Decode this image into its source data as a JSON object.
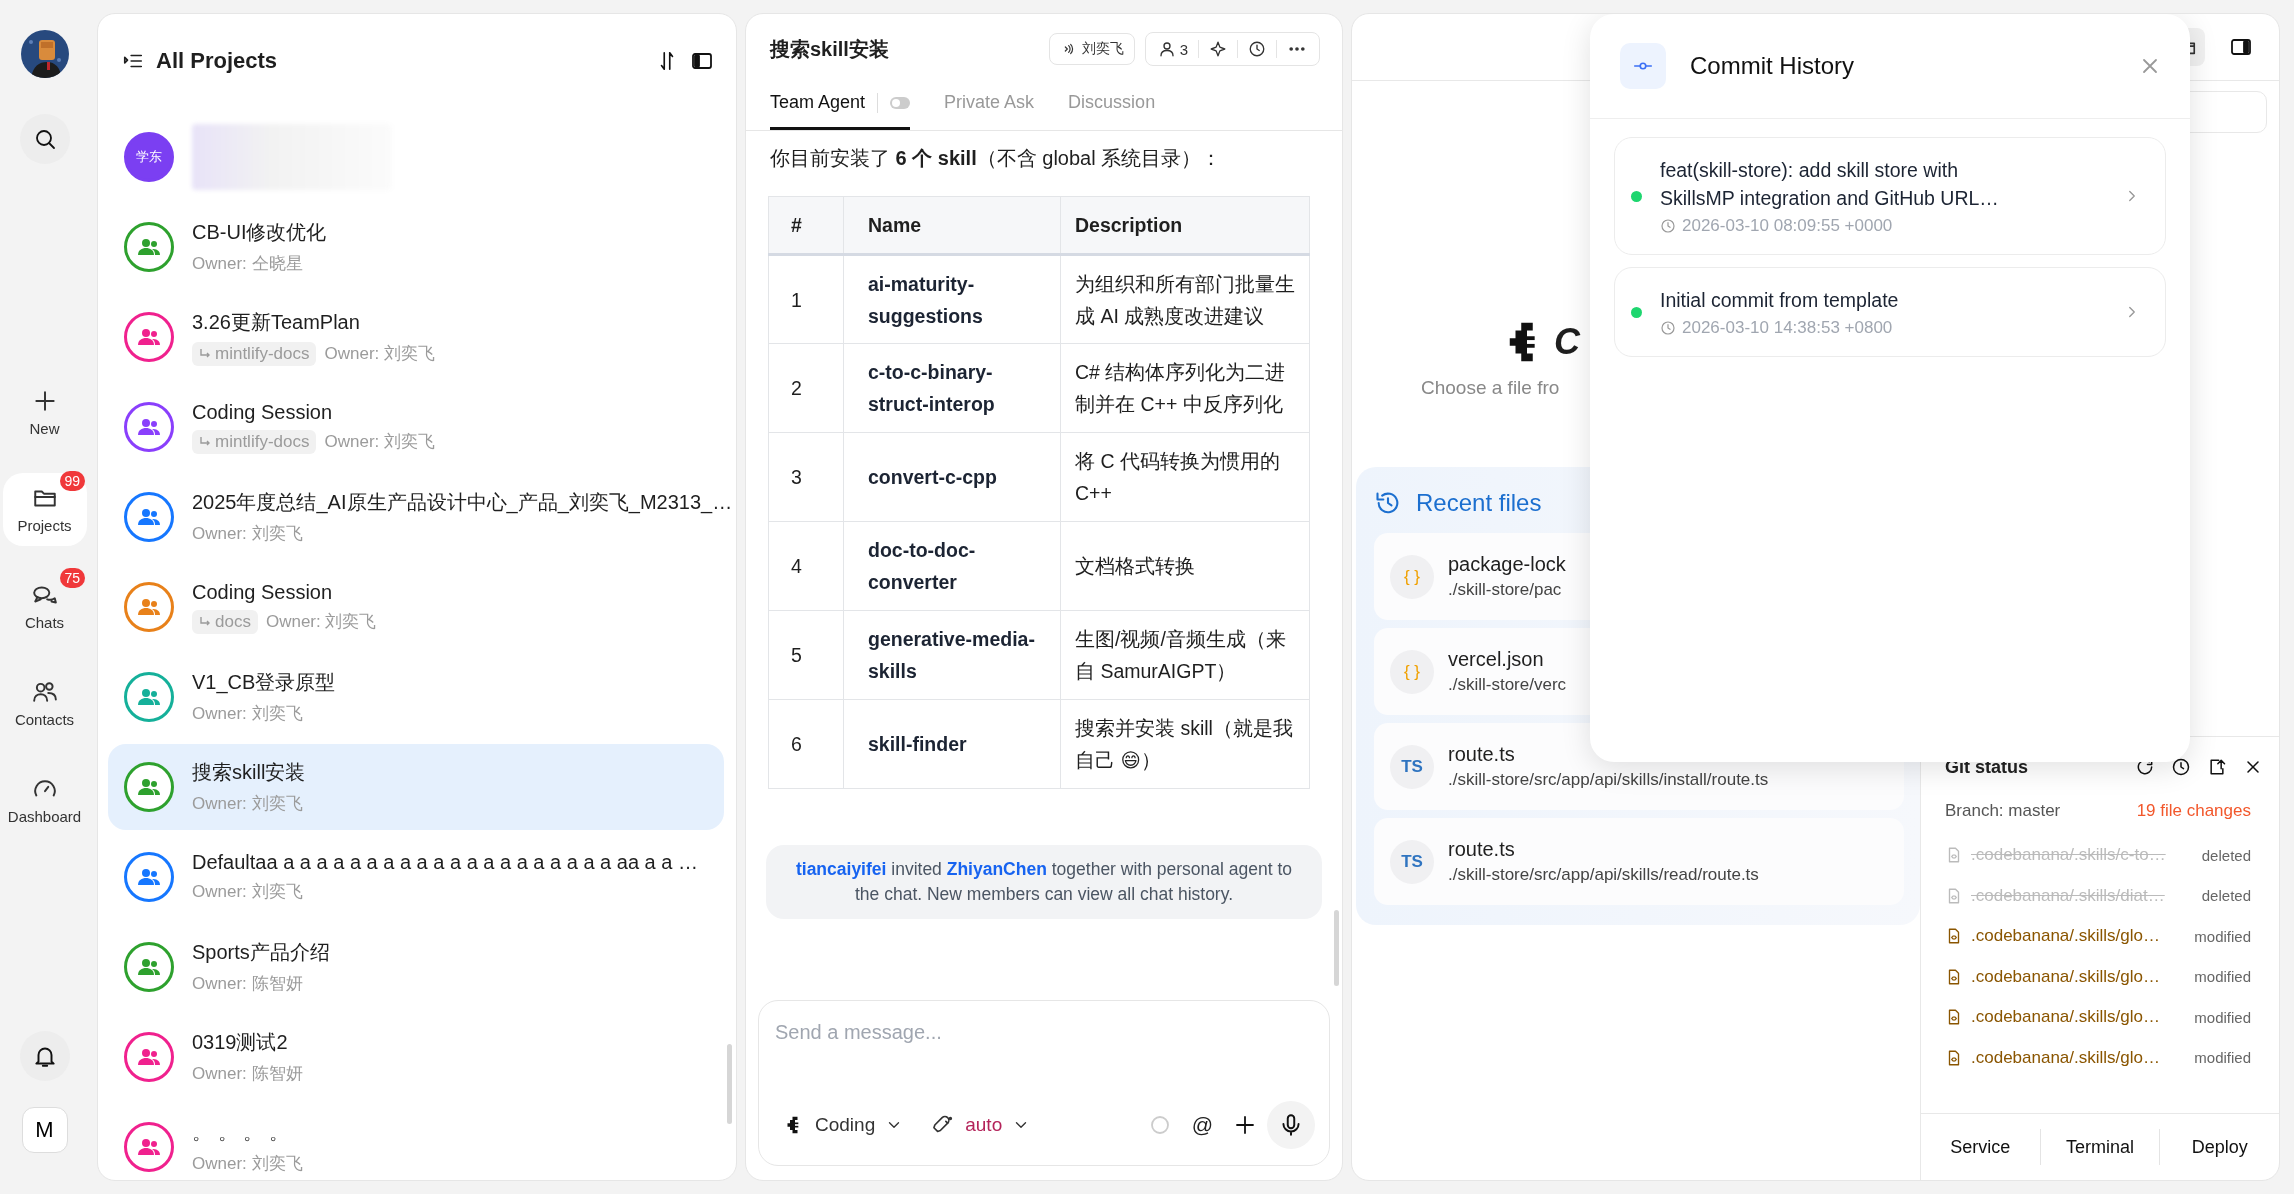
{
  "rail": {
    "items": [
      {
        "kind": "new",
        "label": "New",
        "selected": false
      },
      {
        "kind": "projects",
        "label": "Projects",
        "badge": "99",
        "selected": true
      },
      {
        "kind": "chats",
        "label": "Chats",
        "badge": "75",
        "selected": false
      },
      {
        "kind": "contacts",
        "label": "Contacts",
        "selected": false
      },
      {
        "kind": "dashboard",
        "label": "Dashboard",
        "selected": false
      }
    ],
    "account": "M"
  },
  "projects": {
    "title": "All Projects",
    "items": [
      {
        "kind": "blurred",
        "avatar_text": "学东",
        "color": "#7b3ff2",
        "selected": false
      },
      {
        "kind": "project",
        "name": "CB-UI修改优化",
        "owner": "Owner: 仝晓星",
        "color": "#2ea12e",
        "selected": false
      },
      {
        "kind": "project",
        "name": "3.26更新TeamPlan",
        "branch": "mintlify-docs",
        "owner": "Owner: 刘奕飞",
        "color": "#f0218e",
        "selected": false
      },
      {
        "kind": "project",
        "name": "Coding Session",
        "branch": "mintlify-docs",
        "owner": "Owner: 刘奕飞",
        "color": "#8a3ffc",
        "selected": false
      },
      {
        "kind": "project",
        "name": "2025年度总结_AI原生产品设计中心_产品_刘奕飞_M2313_…",
        "owner": "Owner: 刘奕飞",
        "color": "#1677ff",
        "selected": false
      },
      {
        "kind": "project",
        "name": "Coding Session",
        "branch": "docs",
        "owner": "Owner: 刘奕飞",
        "color": "#e8811a",
        "selected": false
      },
      {
        "kind": "project",
        "name": "V1_CB登录原型",
        "owner": "Owner: 刘奕飞",
        "color": "#15b09a",
        "selected": false
      },
      {
        "kind": "project",
        "name": "搜索skill安装",
        "owner": "Owner: 刘奕飞",
        "color": "#2ea12e",
        "selected": true
      },
      {
        "kind": "project",
        "name": "Defaultaa a a a a a a a a a a a a a a a a a a a a aa a a …",
        "owner": "Owner: 刘奕飞",
        "color": "#1677ff",
        "selected": false
      },
      {
        "kind": "project",
        "name": "Sports产品介绍",
        "owner": "Owner: 陈智妍",
        "color": "#2ea12e",
        "selected": false
      },
      {
        "kind": "project",
        "name": "0319测试2",
        "owner": "Owner: 陈智妍",
        "color": "#f0218e",
        "selected": false
      },
      {
        "kind": "project",
        "name": "。 。 。 。",
        "owner": "Owner: 刘奕飞",
        "color": "#f0218e",
        "selected": false
      }
    ]
  },
  "chat": {
    "title": "搜索skill安装",
    "speaker": "刘奕飞",
    "members": "3",
    "tabs": [
      {
        "label": "Team Agent",
        "selected": true,
        "toggle": {
          "on": false
        }
      },
      {
        "label": "Private Ask",
        "selected": false
      },
      {
        "label": "Discussion",
        "selected": false
      }
    ],
    "intro": "你目前安装了 **6 个 skill**（不含 global 系统目录）：",
    "table": {
      "columns": [
        "#",
        "Name",
        "Description"
      ],
      "rows": [
        [
          "1",
          "ai-maturity-suggestions",
          "为组织和所有部门批量生成 AI 成熟度改进建议"
        ],
        [
          "2",
          "c-to-c-binary-struct-interop",
          "C# 结构体序列化为二进制并在 C++ 中反序列化"
        ],
        [
          "3",
          "convert-c-cpp",
          "将 C 代码转换为惯用的 C++"
        ],
        [
          "4",
          "doc-to-doc-converter",
          "文档格式转换"
        ],
        [
          "5",
          "generative-media-skills",
          "生图/视频/音频生成（来自 SamurAIGPT）"
        ],
        [
          "6",
          "skill-finder",
          "搜索并安装 skill（就是我自己 😄）"
        ]
      ]
    },
    "notice": [
      {
        "kind": "user",
        "text": "tiancaiyifei"
      },
      {
        "kind": "text",
        "text": " invited "
      },
      {
        "kind": "user",
        "text": "ZhiyanChen"
      },
      {
        "kind": "text",
        "text": " together with personal agent to the chat. New members can view all chat history."
      }
    ],
    "composer": {
      "placeholder": "Send a message...",
      "mode": "Coding",
      "model": "auto",
      "mention": "@"
    }
  },
  "workspace": {
    "logo_text": "C",
    "subtitle": "Choose a file fro",
    "recent_title": "Recent files",
    "recent": [
      {
        "kind": "json",
        "badge": "{ }",
        "name": "package-lock",
        "path": "./skill-store/pac"
      },
      {
        "kind": "json",
        "badge": "{ }",
        "name": "vercel.json",
        "path": "./skill-store/verc"
      },
      {
        "kind": "ts",
        "badge": "TS",
        "name": "route.ts",
        "path": "./skill-store/src/app/api/skills/install/route.ts"
      },
      {
        "kind": "ts",
        "badge": "TS",
        "name": "route.ts",
        "path": "./skill-store/src/app/api/skills/read/route.ts"
      }
    ],
    "git": {
      "title": "Git status",
      "branch": "Branch: master",
      "changes": "19 file changes",
      "files": [
        {
          "kind": "deleted",
          "path": ".codebanana/.skills/c-to…",
          "status": "deleted"
        },
        {
          "kind": "deleted",
          "path": ".codebanana/.skills/diat…",
          "status": "deleted"
        },
        {
          "kind": "modified",
          "path": ".codebanana/.skills/glo…",
          "status": "modified"
        },
        {
          "kind": "modified",
          "path": ".codebanana/.skills/glo…",
          "status": "modified"
        },
        {
          "kind": "modified",
          "path": ".codebanana/.skills/glo…",
          "status": "modified"
        },
        {
          "kind": "modified",
          "path": ".codebanana/.skills/glo…",
          "status": "modified"
        }
      ],
      "tabs": [
        "Service",
        "Terminal",
        "Deploy"
      ]
    }
  },
  "commit_history": {
    "title": "Commit History",
    "commits": [
      {
        "message": "feat(skill-store): add skill store with SkillsMP integration and GitHub URL…",
        "time": "2026-03-10 08:09:55 +0000",
        "color": "#1ed66f"
      },
      {
        "message": "Initial commit from template",
        "time": "2026-03-10 14:38:53 +0800",
        "color": "#1ed66f"
      }
    ]
  }
}
